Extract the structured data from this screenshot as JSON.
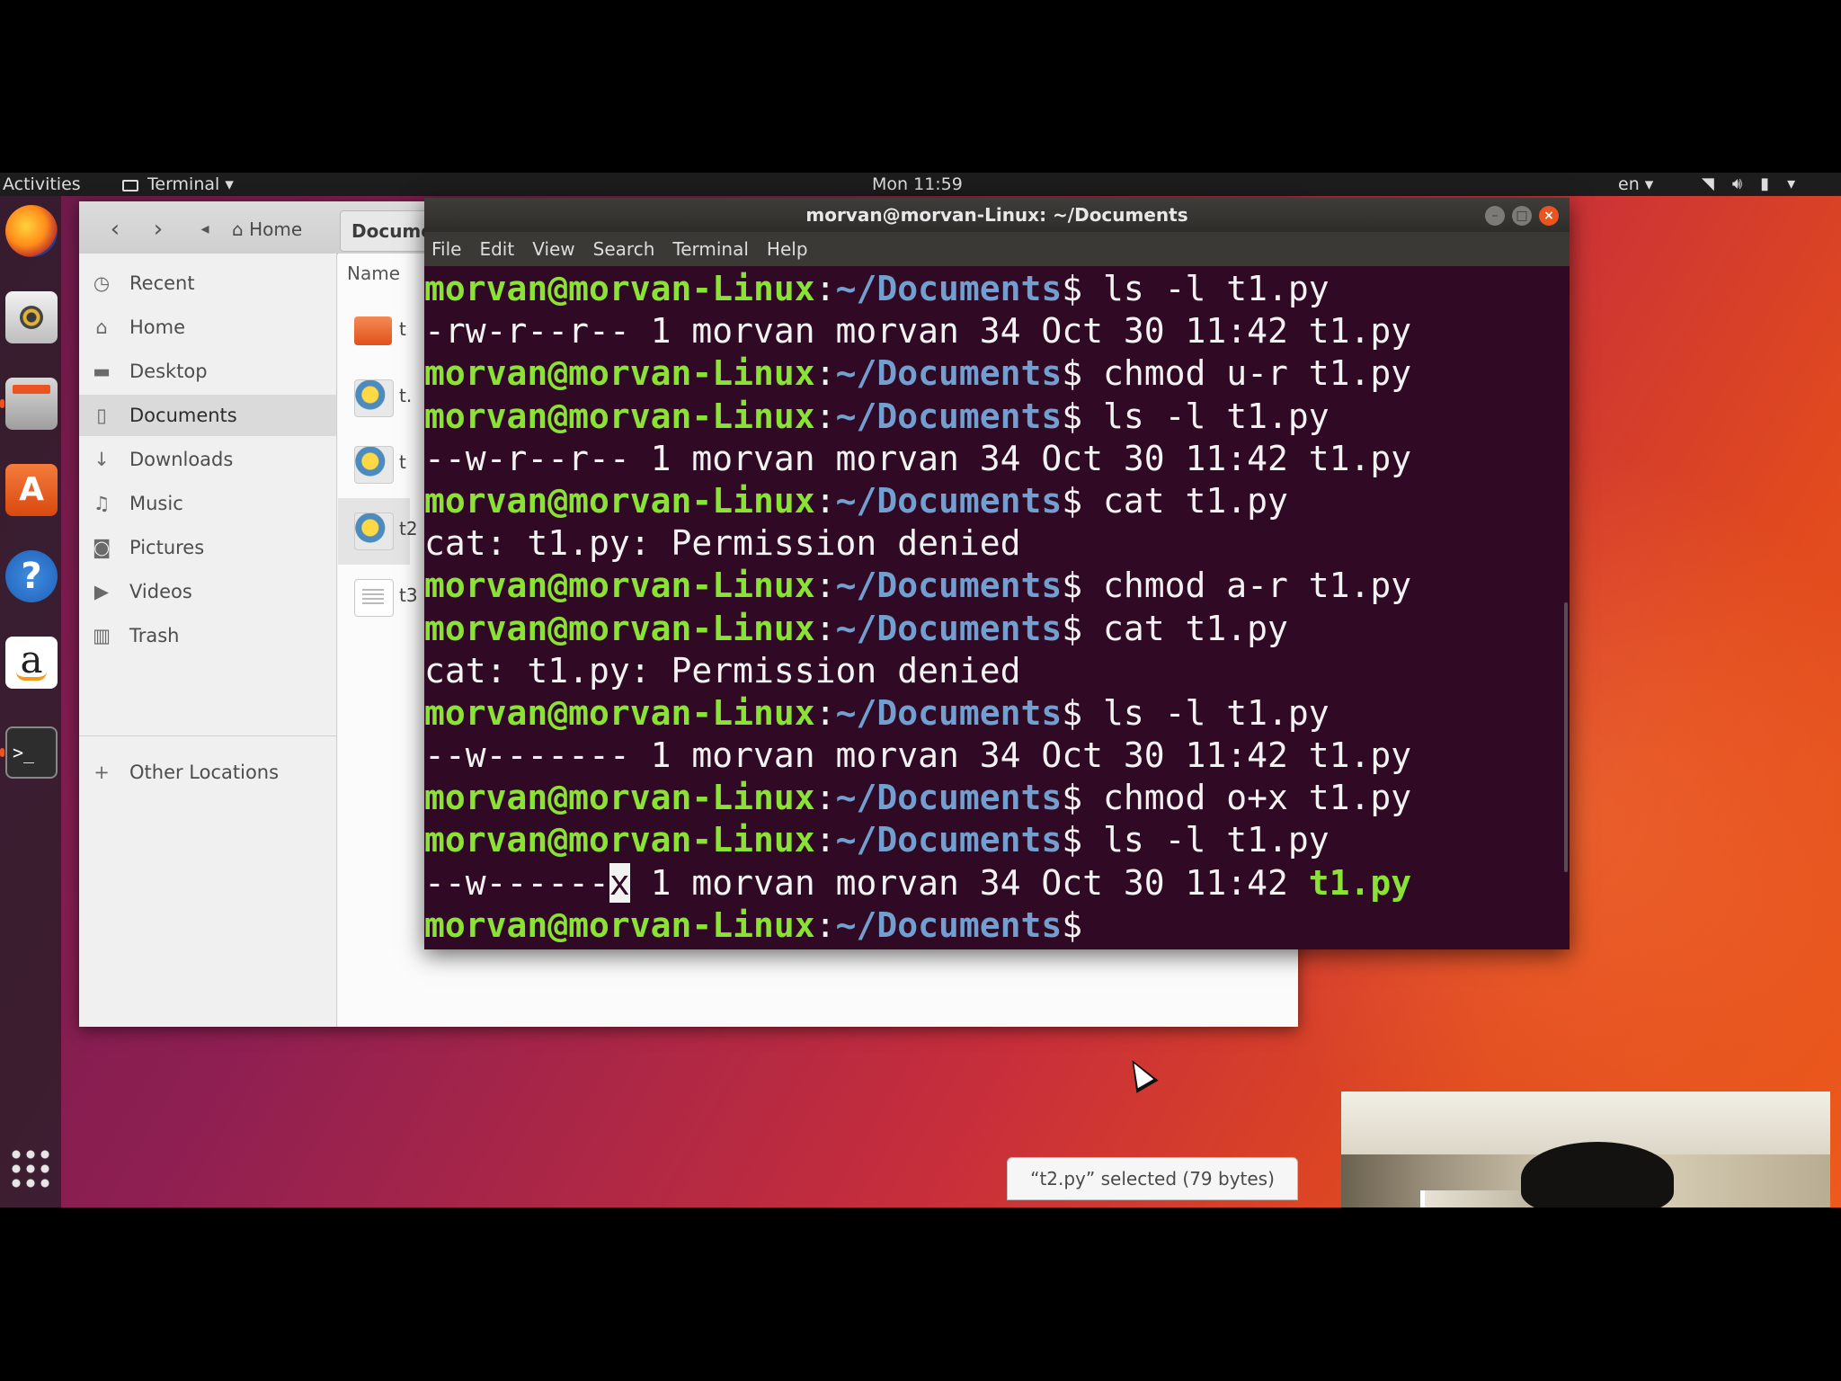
{
  "topbar": {
    "activities": "Activities",
    "app_name": "Terminal",
    "clock": "Mon 11:59",
    "language": "en",
    "status_icons": [
      "wifi-icon",
      "volume-icon",
      "battery-icon",
      "system-menu-icon"
    ]
  },
  "dock": {
    "apps": [
      "firefox-icon",
      "rhythmbox-icon",
      "files-icon",
      "software-center-icon",
      "help-icon",
      "amazon-icon",
      "terminal-icon",
      "show-apps-icon"
    ],
    "amazon_glyph": "a",
    "help_glyph": "?",
    "software_glyph": "A",
    "terminal_glyph": ">_"
  },
  "files": {
    "nav_home": "Home",
    "nav_current": "Docume",
    "column_name": "Name",
    "sidebar": [
      {
        "label": "Recent",
        "icon": "clock-icon"
      },
      {
        "label": "Home",
        "icon": "home-icon"
      },
      {
        "label": "Desktop",
        "icon": "desktop-folder-icon"
      },
      {
        "label": "Documents",
        "icon": "document-icon"
      },
      {
        "label": "Downloads",
        "icon": "download-icon"
      },
      {
        "label": "Music",
        "icon": "music-icon"
      },
      {
        "label": "Pictures",
        "icon": "camera-icon"
      },
      {
        "label": "Videos",
        "icon": "video-icon"
      },
      {
        "label": "Trash",
        "icon": "trash-icon"
      },
      {
        "label": "Other Locations",
        "icon": "plus-icon"
      }
    ],
    "file_labels": [
      "t",
      "t.",
      "t",
      "t2",
      "t3"
    ],
    "status": "“t2.py” selected  (79 bytes)"
  },
  "terminal": {
    "title": "morvan@morvan-Linux: ~/Documents",
    "menu": [
      "File",
      "Edit",
      "View",
      "Search",
      "Terminal",
      "Help"
    ],
    "user_host": "morvan@morvan-Linux",
    "path": "~/Documents",
    "lines": [
      {
        "type": "prompt",
        "cmd": " ls -l t1.py"
      },
      {
        "type": "out",
        "text": "-rw-r--r-- 1 morvan morvan 34 Oct 30 11:42 t1.py"
      },
      {
        "type": "prompt",
        "cmd": " chmod u-r t1.py"
      },
      {
        "type": "prompt",
        "cmd": " ls -l t1.py"
      },
      {
        "type": "out",
        "text": "--w-r--r-- 1 morvan morvan 34 Oct 30 11:42 t1.py"
      },
      {
        "type": "prompt",
        "cmd": " cat t1.py"
      },
      {
        "type": "out",
        "text": "cat: t1.py: Permission denied"
      },
      {
        "type": "prompt",
        "cmd": " chmod a-r t1.py"
      },
      {
        "type": "prompt",
        "cmd": " cat t1.py"
      },
      {
        "type": "out",
        "text": "cat: t1.py: Permission denied"
      },
      {
        "type": "prompt",
        "cmd": " ls -l t1.py"
      },
      {
        "type": "out",
        "text": "--w------- 1 morvan morvan 34 Oct 30 11:42 t1.py"
      },
      {
        "type": "prompt",
        "cmd": " chmod o+x t1.py"
      },
      {
        "type": "prompt",
        "cmd": " ls -l t1.py"
      },
      {
        "type": "last_out",
        "perm_prefix": "--w------",
        "cursor_char": "x",
        "middle": " 1 morvan morvan 34 Oct 30 11:42 ",
        "filename": "t1.py"
      },
      {
        "type": "prompt",
        "cmd": ""
      }
    ]
  }
}
